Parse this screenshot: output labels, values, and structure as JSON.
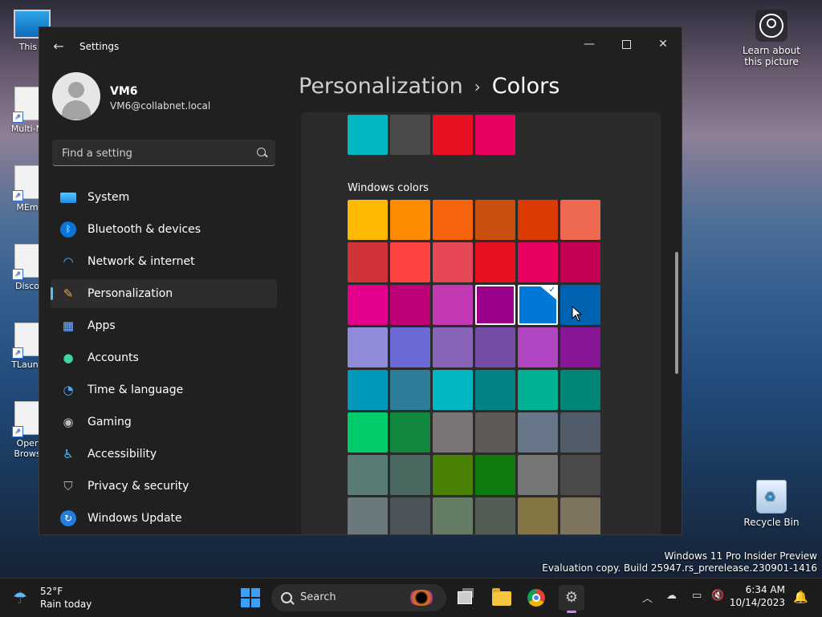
{
  "desktop": {
    "icons": [
      {
        "label": "This P"
      },
      {
        "label": "Multi-M"
      },
      {
        "label": "MEm"
      },
      {
        "label": "Disco"
      },
      {
        "label": "TLaunc"
      },
      {
        "label": "Oper Brows"
      }
    ],
    "learn_label": "Learn about this picture",
    "recycle_label": "Recycle Bin",
    "watermark_line1": "Windows 11 Pro Insider Preview",
    "watermark_line2": "Evaluation copy. Build 25947.rs_prerelease.230901-1416"
  },
  "window": {
    "title": "Settings",
    "back_glyph": "←",
    "min_glyph": "—",
    "close_glyph": "✕"
  },
  "profile": {
    "name": "VM6",
    "email": "VM6@collabnet.local"
  },
  "search": {
    "placeholder": "Find a setting"
  },
  "nav": {
    "items": [
      {
        "label": "System",
        "icon": "system-icon"
      },
      {
        "label": "Bluetooth & devices",
        "icon": "bluetooth-icon"
      },
      {
        "label": "Network & internet",
        "icon": "wifi-icon"
      },
      {
        "label": "Personalization",
        "icon": "brush-icon",
        "active": true
      },
      {
        "label": "Apps",
        "icon": "apps-icon"
      },
      {
        "label": "Accounts",
        "icon": "person-icon"
      },
      {
        "label": "Time & language",
        "icon": "globe-clock-icon"
      },
      {
        "label": "Gaming",
        "icon": "gamepad-icon"
      },
      {
        "label": "Accessibility",
        "icon": "accessibility-icon"
      },
      {
        "label": "Privacy & security",
        "icon": "shield-icon"
      },
      {
        "label": "Windows Update",
        "icon": "update-icon"
      }
    ]
  },
  "breadcrumb": {
    "parent": "Personalization",
    "separator": "›",
    "current": "Colors"
  },
  "recent_colors": [
    "#00b7c3",
    "#4c4a48",
    "#e81123",
    "#ea005e"
  ],
  "windows_colors": {
    "label": "Windows colors",
    "rows": [
      [
        "#ffb900",
        "#ff8c00",
        "#f7630c",
        "#ca5010",
        "#da3b01",
        "#ef6950"
      ],
      [
        "#d13438",
        "#ff4343",
        "#e74856",
        "#e81123",
        "#ea005e",
        "#c30052"
      ],
      [
        "#e3008c",
        "#bf0077",
        "#c239b3",
        "#9a0089",
        "#0078d7",
        "#0063b1"
      ],
      [
        "#8e8cd8",
        "#6b69d6",
        "#8764b8",
        "#744da9",
        "#b146c2",
        "#881798"
      ],
      [
        "#0099bc",
        "#2d7d9a",
        "#00b7c3",
        "#038387",
        "#00b294",
        "#018574"
      ],
      [
        "#00cc6a",
        "#10893e",
        "#7a7574",
        "#5d5a58",
        "#68768a",
        "#515c6b"
      ],
      [
        "#567c73",
        "#486860",
        "#498205",
        "#107c10",
        "#767676",
        "#4c4a48"
      ],
      [
        "#69797e",
        "#4a5459",
        "#647c64",
        "#525e54",
        "#847545",
        "#7e735f"
      ]
    ],
    "focused": {
      "row": 2,
      "col": 3
    },
    "selected": {
      "row": 2,
      "col": 4
    },
    "check_glyph": "✓"
  },
  "taskbar": {
    "temp": "52°F",
    "weather_desc": "Rain today",
    "search_label": "Search",
    "time": "6:34 AM",
    "date": "10/14/2023",
    "tray_glyphs": {
      "chevron": "︿",
      "bell": "🔔"
    }
  }
}
